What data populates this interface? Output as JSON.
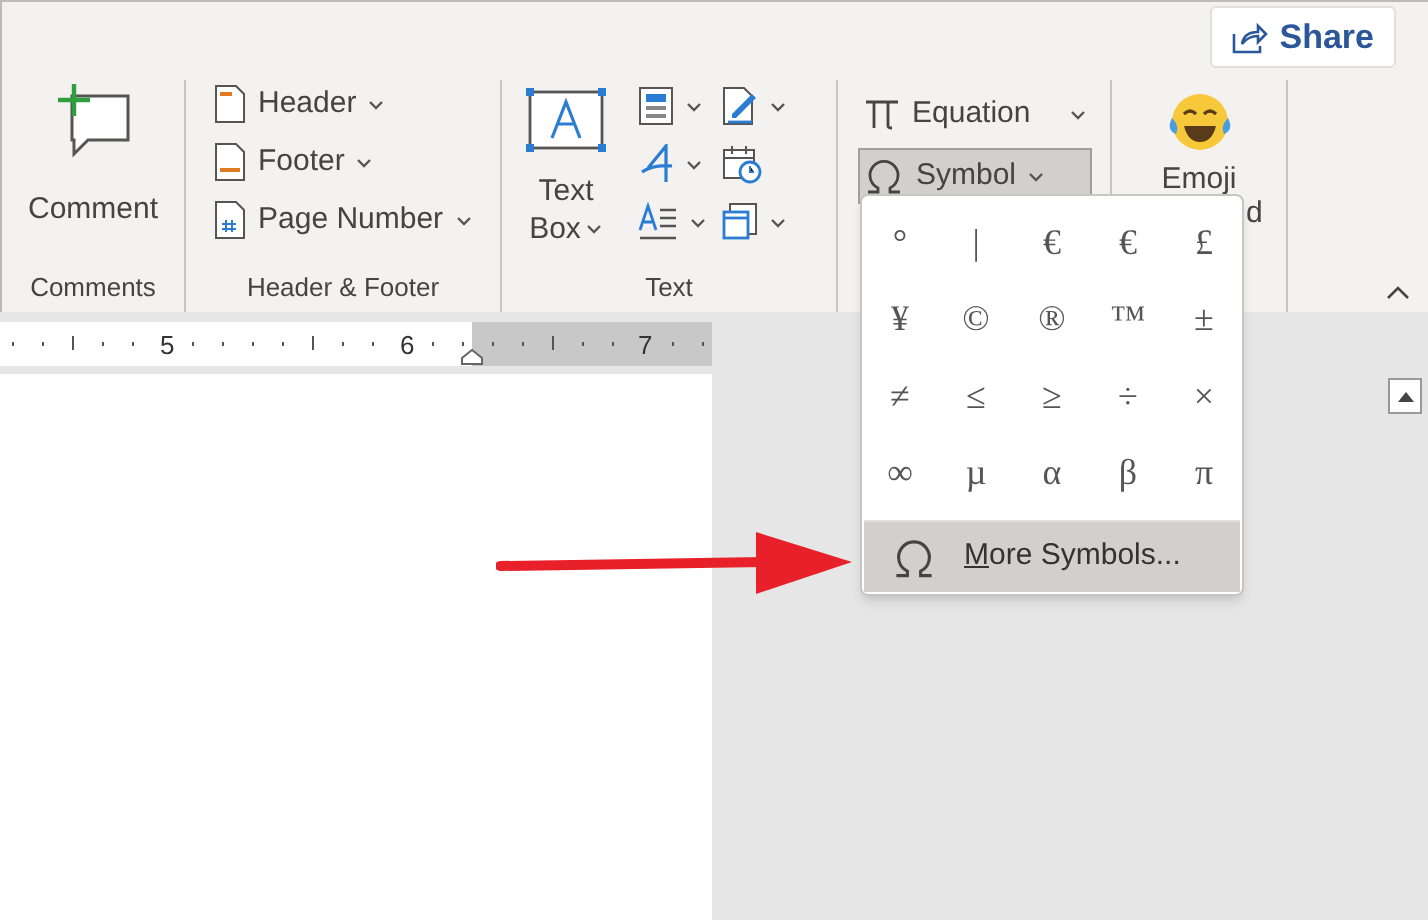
{
  "share_button": {
    "label": "Share"
  },
  "ribbon": {
    "groups": [
      {
        "kind": "comments",
        "label": "Comments",
        "items": [
          {
            "label": "Comment"
          }
        ]
      },
      {
        "kind": "header_footer",
        "label": "Header & Footer",
        "items": [
          {
            "label": "Header"
          },
          {
            "label": "Footer"
          },
          {
            "label": "Page Number"
          }
        ]
      },
      {
        "kind": "text",
        "label": "Text",
        "items": [
          {
            "label": "Text",
            "label_2": "Box"
          }
        ]
      },
      {
        "kind": "symbols",
        "items": [
          {
            "label": "Equation",
            "selected": false
          },
          {
            "label": "Symbol",
            "selected": true
          }
        ]
      },
      {
        "kind": "emoji",
        "items": [
          {
            "label": "Emoji",
            "label_2": "d"
          }
        ]
      }
    ]
  },
  "ruler": {
    "labels": [
      "5",
      "6",
      "7"
    ]
  },
  "symbol_menu": {
    "symbols": [
      "°",
      "|",
      "€",
      "€",
      "£",
      "¥",
      "©",
      "®",
      "™",
      "±",
      "≠",
      "≤",
      "≥",
      "÷",
      "×",
      "∞",
      "µ",
      "α",
      "β",
      "π"
    ],
    "more_item": {
      "label": "More Symbols...",
      "selected": true
    }
  }
}
